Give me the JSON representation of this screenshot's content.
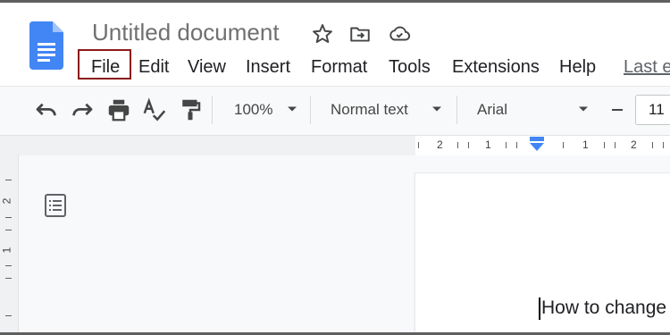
{
  "document": {
    "title": "Untitled document"
  },
  "menubar": {
    "items": [
      "File",
      "Edit",
      "View",
      "Insert",
      "Format",
      "Tools",
      "Extensions",
      "Help"
    ],
    "last_edit": "Last e"
  },
  "toolbar": {
    "zoom": "100%",
    "style": "Normal text",
    "font": "Arial",
    "font_size": "11"
  },
  "ruler": {
    "labels": [
      "2",
      "1",
      "1",
      "2"
    ]
  },
  "vertical_ruler": {
    "labels": [
      "2",
      "1"
    ]
  },
  "page": {
    "text": "How to change"
  },
  "icons": {
    "logo": "google-docs-logo",
    "star": "star-icon",
    "move": "move-to-folder-icon",
    "cloud": "cloud-status-icon",
    "undo": "undo-icon",
    "redo": "redo-icon",
    "print": "print-icon",
    "spellcheck": "spellcheck-icon",
    "paint_format": "paint-format-icon",
    "outline": "document-outline-icon"
  },
  "colors": {
    "accent_blue": "#4285f4",
    "highlight_border": "#8b1a1a"
  }
}
